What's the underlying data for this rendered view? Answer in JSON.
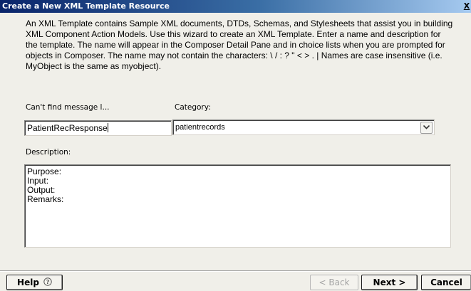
{
  "window": {
    "title": "Create a New XML Template Resource",
    "close_label": "X"
  },
  "intro_text": "An XML Template contains Sample XML documents, DTDs, Schemas, and Stylesheets that assist you in building XML Component Action Models. Use this wizard to create an XML Template. Enter a name and description for the template. The name will appear in the Composer Detail Pane and in choice lists when you are prompted for objects in Composer. The name may not contain the characters: \\ / : ? \" < > . | Names are case insensitive (i.e. MyObject is the same as myobject).",
  "form": {
    "name_label": "Can't find message l...",
    "name_value": "PatientRecResponse",
    "category_label": "Category:",
    "category_value": "patientrecords",
    "description_label": "Description:",
    "description_lines": [
      "Purpose:",
      "Input:",
      "Output:",
      "Remarks:"
    ]
  },
  "buttons": {
    "help": "Help",
    "back": "< Back",
    "next": "Next >",
    "cancel": "Cancel"
  },
  "icons": {
    "help": "question-circle-icon",
    "dropdown": "chevron-down-icon"
  }
}
